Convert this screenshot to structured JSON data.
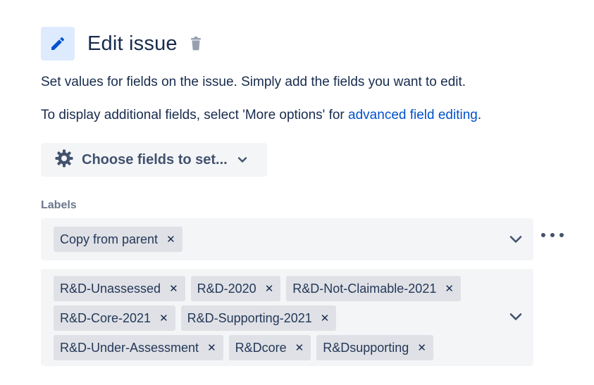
{
  "header": {
    "title": "Edit issue",
    "icon": "pencil-icon",
    "delete_icon": "trash-icon"
  },
  "description": {
    "line1": "Set values for fields on the issue. Simply add the fields you want to edit.",
    "line2_prefix": "To display additional fields, select 'More options' for ",
    "line2_link": "advanced field editing",
    "line2_suffix": "."
  },
  "choose_fields": {
    "label": "Choose fields to set...",
    "icon": "gear-icon",
    "chevron": "chevron-down-icon"
  },
  "labels_field": {
    "heading": "Labels",
    "mode_select": {
      "tags": [
        "Copy from parent"
      ]
    },
    "values_select": {
      "tags": [
        "R&D-Unassessed",
        "R&D-2020",
        "R&D-Not-Claimable-2021",
        "R&D-Core-2021",
        "R&D-Supporting-2021",
        "R&D-Under-Assessment",
        "R&Dcore",
        "R&Dsupporting"
      ]
    },
    "remove_glyph": "✕",
    "more_icon": "more-options-icon"
  },
  "colors": {
    "text": "#172b4d",
    "link": "#0052cc",
    "badge_bg": "#deebff",
    "pencil": "#0052cc",
    "field_bg": "#f4f5f7",
    "tag_bg": "#dfe1e6",
    "muted": "#6b778c"
  }
}
